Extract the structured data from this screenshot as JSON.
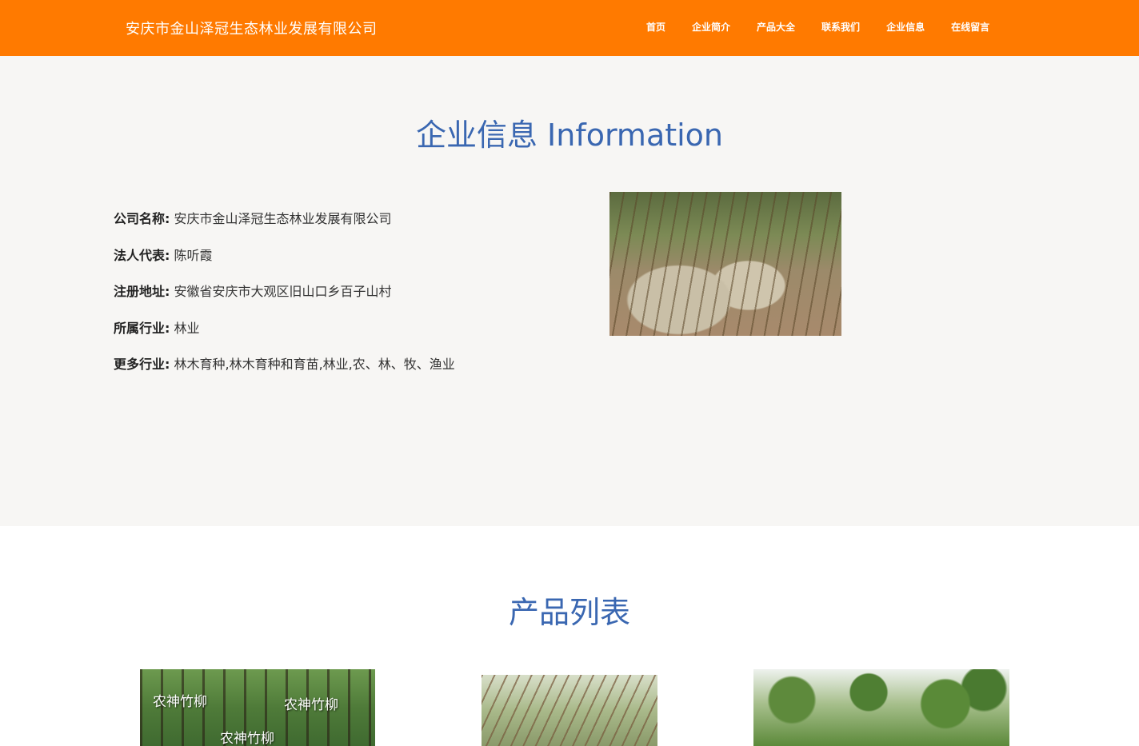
{
  "header": {
    "brand": "安庆市金山泽冠生态林业发展有限公司",
    "nav": [
      "首页",
      "企业简介",
      "产品大全",
      "联系我们",
      "企业信息",
      "在线留言"
    ],
    "background": "#ff7a00"
  },
  "info": {
    "title": "企业信息 Information",
    "rows": [
      {
        "key": "公司名称:",
        "value": "安庆市金山泽冠生态林业发展有限公司"
      },
      {
        "key": "法人代表:",
        "value": "陈听霞"
      },
      {
        "key": "注册地址:",
        "value": "安徽省安庆市大观区旧山口乡百子山村"
      },
      {
        "key": "所属行业:",
        "value": "林业"
      },
      {
        "key": "更多行业:",
        "value": "林木育种,林木育种和育苗,林业,农、林、牧、渔业"
      }
    ]
  },
  "products": {
    "title": "产品列表",
    "watermarks": [
      "农神竹柳",
      "农神竹柳",
      "农神竹柳"
    ]
  },
  "colors": {
    "accent": "#ff7a00",
    "title_blue": "#3a67b1",
    "info_background": "#f7f6f4"
  }
}
